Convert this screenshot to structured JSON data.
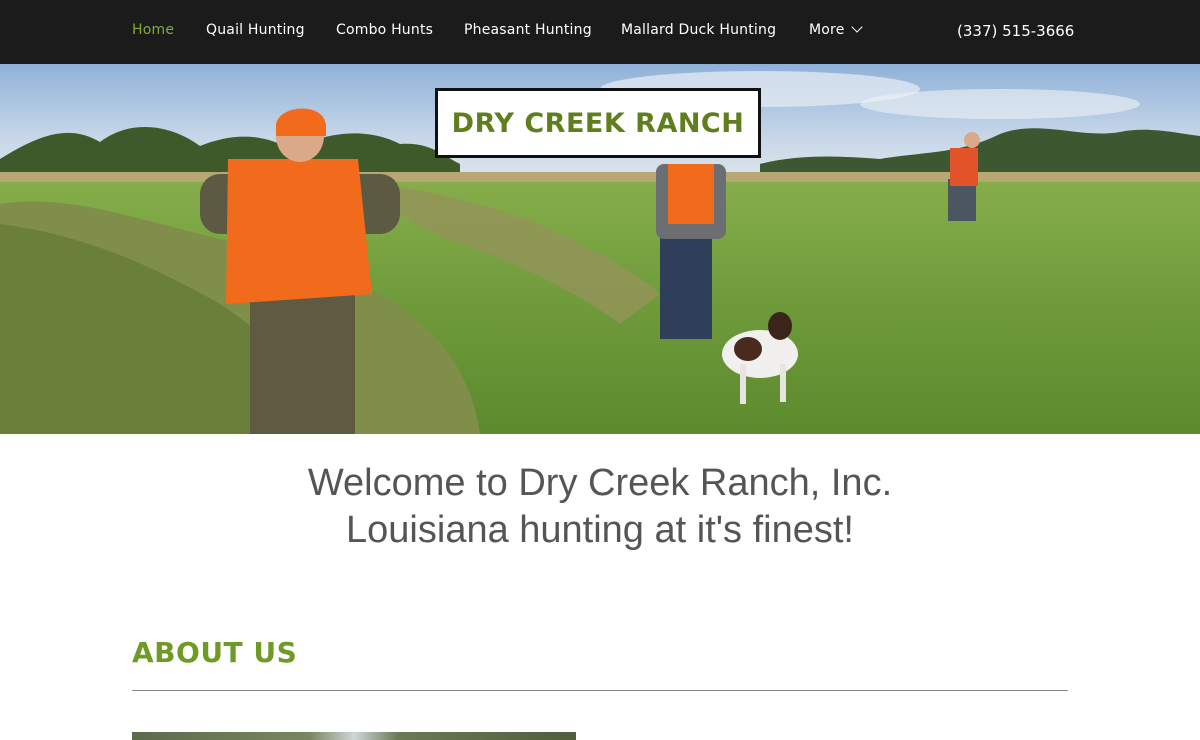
{
  "nav": {
    "items": [
      {
        "label": "Home",
        "active": true
      },
      {
        "label": "Quail Hunting",
        "active": false
      },
      {
        "label": "Combo Hunts",
        "active": false
      },
      {
        "label": "Pheasant Hunting",
        "active": false
      },
      {
        "label": "Mallard Duck Hunting",
        "active": false
      },
      {
        "label": "More",
        "active": false
      }
    ],
    "phone": "(337) 515-3666"
  },
  "hero": {
    "title": "DRY CREEK RANCH"
  },
  "welcome": {
    "line1": "Welcome to Dry Creek Ranch, Inc.",
    "line2": "Louisiana hunting at it's finest!"
  },
  "about": {
    "heading": "ABOUT US"
  },
  "colors": {
    "accent": "#6f9a26",
    "nav_bg": "#1b1b1b",
    "text": "#555555"
  }
}
